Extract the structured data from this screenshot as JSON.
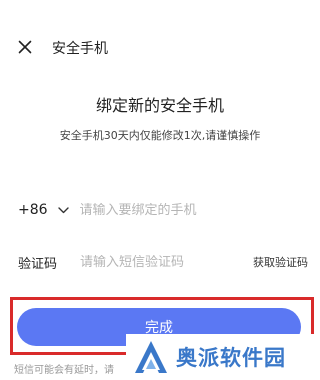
{
  "header": {
    "title": "安全手机",
    "close_icon": "close-icon"
  },
  "main": {
    "title": "绑定新的安全手机",
    "subtitle": "安全手机30天内仅能修改1次,请谨慎操作"
  },
  "phone_row": {
    "country_code": "+86",
    "placeholder": "请输入要绑定的手机",
    "value": ""
  },
  "code_row": {
    "label": "验证码",
    "placeholder": "请输入短信验证码",
    "value": "",
    "get_code_label": "获取验证码"
  },
  "done_button": {
    "label": "完成"
  },
  "footnote": "短信可能会有延时，请",
  "watermark": {
    "text": "奥派软件园",
    "logo_icon": "watermark-logo-icon"
  },
  "colors": {
    "accent": "#5b78f3",
    "highlight": "#d92a2a",
    "watermark": "#3a78c9"
  }
}
